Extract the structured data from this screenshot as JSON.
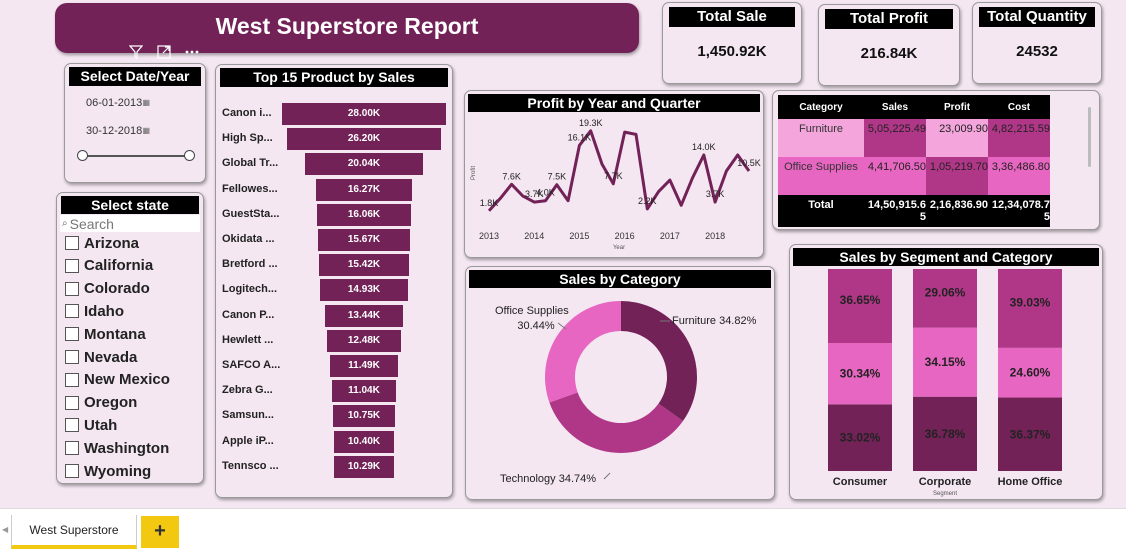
{
  "report": {
    "title": "West Superstore Report"
  },
  "kpis": [
    {
      "title": "Total Sale",
      "value": "1,450.92K"
    },
    {
      "title": "Total Profit",
      "value": "216.84K"
    },
    {
      "title": "Total Quantity",
      "value": "24532"
    }
  ],
  "date_filter": {
    "title": "Select Date/Year",
    "start": "06-01-2013",
    "end": "30-12-2018"
  },
  "state_filter": {
    "title": "Select state",
    "search_placeholder": "Search",
    "states": [
      "Arizona",
      "California",
      "Colorado",
      "Idaho",
      "Montana",
      "Nevada",
      "New Mexico",
      "Oregon",
      "Utah",
      "Washington",
      "Wyoming"
    ]
  },
  "icons": {
    "filter": "filter-icon",
    "focus": "focus-mode-icon",
    "more": "more-options-icon",
    "calendar": "calendar-icon",
    "search": "search-icon"
  },
  "colors": {
    "dark": "#722257",
    "mid": "#b03787",
    "light": "#e766c1",
    "pale": "#f3a5dc",
    "background": "#f4e7f2",
    "tab_accent": "#f2c811"
  },
  "matrix": {
    "headers": [
      "Category",
      "Sales",
      "Profit",
      "Cost"
    ],
    "rows": [
      {
        "category": "Furniture",
        "sales": "5,05,225.49",
        "profit": "23,009.90",
        "cost": "4,82,215.59"
      },
      {
        "category": "Office Supplies",
        "sales": "4,41,706.50",
        "profit": "1,05,219.70",
        "cost": "3,36,486.80"
      }
    ],
    "total": {
      "label": "Total",
      "sales": "14,50,915.65",
      "profit": "2,16,836.90",
      "cost": "12,34,078.75"
    }
  },
  "chart_data": [
    {
      "type": "bar",
      "orientation": "horizontal-funnel",
      "title": "Top 15 Product by Sales",
      "categories": [
        "Canon i...",
        "High Sp...",
        "Global Tr...",
        "Fellowes...",
        "GuestSta...",
        "Okidata ...",
        "Bretford ...",
        "Logitech...",
        "Canon P...",
        "Hewlett ...",
        "SAFCO A...",
        "Zebra G...",
        "Samsun...",
        "Apple iP...",
        "Tennsco ..."
      ],
      "values": [
        28.0,
        26.2,
        20.04,
        16.27,
        16.06,
        15.67,
        15.42,
        14.93,
        13.44,
        12.48,
        11.49,
        11.04,
        10.75,
        10.4,
        10.29
      ],
      "labels": [
        "28.00K",
        "26.20K",
        "20.04K",
        "16.27K",
        "16.06K",
        "15.67K",
        "15.42K",
        "14.93K",
        "13.44K",
        "12.48K",
        "11.49K",
        "11.04K",
        "10.75K",
        "10.40K",
        "10.29K"
      ],
      "unit": "K"
    },
    {
      "type": "line",
      "title": "Profit by Year and Quarter",
      "xlabel": "Year",
      "ylabel": "Profit",
      "xticks": [
        "2013",
        "2014",
        "2015",
        "2016",
        "2017",
        "2018"
      ],
      "x": [
        2013.0,
        2013.25,
        2013.5,
        2013.75,
        2014.0,
        2014.25,
        2014.5,
        2014.75,
        2015.0,
        2015.25,
        2015.5,
        2015.75,
        2016.0,
        2016.25,
        2016.5,
        2016.75,
        2017.0,
        2017.25,
        2017.5,
        2017.75,
        2018.0,
        2018.25,
        2018.5,
        2018.75
      ],
      "values": [
        1.8,
        4.5,
        7.6,
        5.0,
        3.7,
        4.0,
        7.5,
        4.0,
        16.1,
        19.3,
        12.0,
        7.7,
        19.0,
        18.5,
        2.2,
        6.0,
        8.5,
        3.0,
        9.0,
        14.0,
        3.7,
        10.5,
        14.0,
        10.5
      ],
      "point_labels": [
        {
          "index": 0,
          "text": "1.8K"
        },
        {
          "index": 2,
          "text": "7.6K"
        },
        {
          "index": 4,
          "text": "3.7K"
        },
        {
          "index": 5,
          "text": "4.0K"
        },
        {
          "index": 6,
          "text": "7.5K"
        },
        {
          "index": 8,
          "text": "16.1K"
        },
        {
          "index": 9,
          "text": "19.3K"
        },
        {
          "index": 11,
          "text": "7.7K"
        },
        {
          "index": 14,
          "text": "2.2K"
        },
        {
          "index": 19,
          "text": "14.0K"
        },
        {
          "index": 20,
          "text": "3.7K"
        },
        {
          "index": 23,
          "text": "10.5K"
        }
      ],
      "ylim": [
        0,
        21
      ]
    },
    {
      "type": "pie",
      "donut": true,
      "title": "Sales by Category",
      "categories": [
        "Furniture",
        "Technology",
        "Office Supplies"
      ],
      "values": [
        34.82,
        34.74,
        30.44
      ],
      "labels": [
        "Furniture 34.82%",
        "Technology 34.74%",
        "Office Supplies 30.44%"
      ],
      "colors": [
        "#722257",
        "#b03787",
        "#e766c1"
      ]
    },
    {
      "type": "bar",
      "stacked": true,
      "percent": true,
      "title": "Sales by Segment and Category",
      "xlabel": "Segment",
      "categories": [
        "Consumer",
        "Corporate",
        "Home Office"
      ],
      "series": [
        {
          "values": [
            33.02,
            36.78,
            36.37
          ],
          "color": "#722257"
        },
        {
          "values": [
            30.34,
            34.15,
            24.6
          ],
          "color": "#e766c1"
        },
        {
          "values": [
            36.65,
            29.06,
            39.03
          ],
          "color": "#b03787"
        }
      ]
    }
  ],
  "tabs": {
    "active": "West Superstore",
    "add": "+"
  }
}
